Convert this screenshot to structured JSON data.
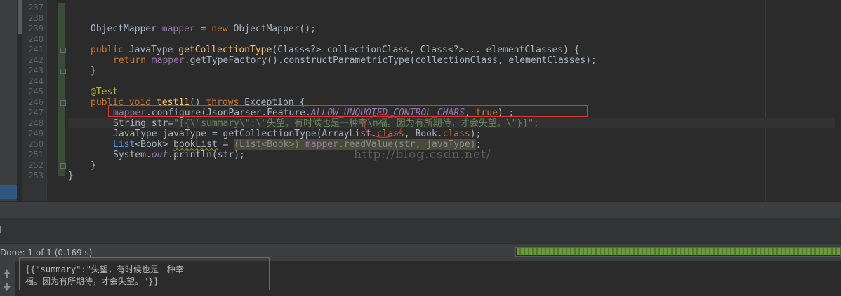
{
  "editor": {
    "line_numbers": [
      "237",
      "238",
      "239",
      "240",
      "241",
      "242",
      "243",
      "244",
      "245",
      "246",
      "247",
      "248",
      "249",
      "250",
      "251",
      "252",
      "253"
    ],
    "l239": {
      "type": "ObjectMapper ",
      "var": "mapper",
      "eq": " = ",
      "new": "new",
      "rest": " ObjectMapper();"
    },
    "l241": {
      "kw": "public",
      "type": " JavaType ",
      "fn": "getCollectionType",
      "rest": "(Class<?> collectionClass, Class<?>... elementClasses) {"
    },
    "l242": {
      "kw": "return ",
      "var": "mapper",
      "rest": ".getTypeFactory().constructParametricType(collectionClass, elementClasses);"
    },
    "l243": {
      "text": "}"
    },
    "l245": {
      "ann": "@Test"
    },
    "l246": {
      "kw1": "public ",
      "kw2": "void ",
      "fn": "test11",
      "p1": "() ",
      "kw3": "throws",
      "rest": " Exception {"
    },
    "l247": {
      "var": "mapper",
      "a": ".configure(JsonParser.Feature.",
      "c": "ALLOW_UNQUOTED_CONTROL_CHARS",
      "b": ", ",
      "tru": "true",
      "end": ") ;"
    },
    "l248": {
      "a": "String str=",
      "s": "\"[{\\\"summary\\\":\\\"失望，有时候也是一种幸\\n福。因为有所期待，才会失望。\\\"}]\";"
    },
    "l249": {
      "a": "JavaType javaType = getCollectionType(ArrayList.",
      "k1": "class",
      "b": ", Book.",
      "k2": "class",
      "c": ");"
    },
    "l250": {
      "lst": "List",
      "a": "<Book> ",
      "bl": "bookList",
      "b": " = ",
      "hl1": "(List<Book>) ",
      "hv": "mapper",
      "hl2": ".readValue(str, javaType)",
      "c": ";"
    },
    "l251": {
      "a": "System.",
      "out": "out",
      "b": ".println(str);"
    },
    "l252": {
      "text": "}"
    },
    "l253": {
      "text": "}"
    },
    "watermark": "http://blog.csdn.net/"
  },
  "run": {
    "status": "Done: 1 of 1 (0.169 s)",
    "progress_fraction": 1.0
  },
  "console": {
    "line1": "[{\"summary\":\"失望，有时候也是一种幸",
    "line2": "福。因为有所期待，才会失望。\"}]"
  },
  "colors": {
    "keyword": "#cc7832",
    "field": "#9876aa",
    "string": "#6a8759",
    "method": "#ffc66d",
    "annotation": "#bbb529",
    "annotation_box": "#d93a3a",
    "progress": "#6a9a3c"
  }
}
